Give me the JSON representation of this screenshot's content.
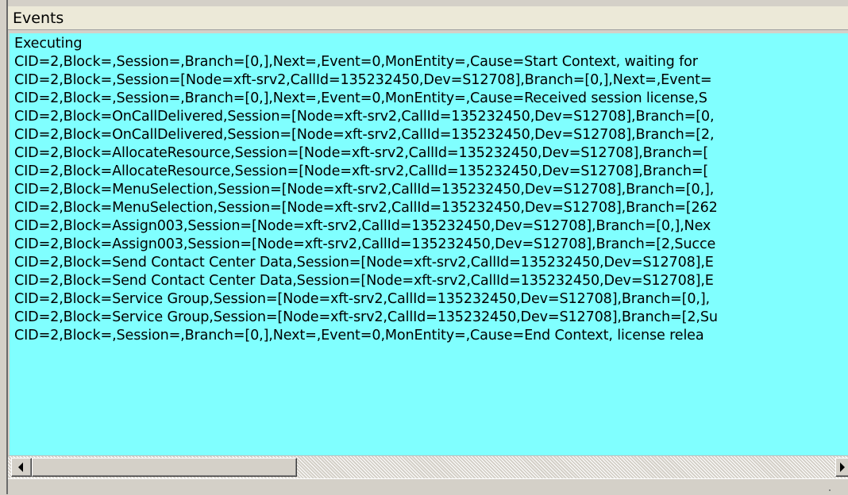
{
  "panel": {
    "title": "Events"
  },
  "events": {
    "lines": [
      "Executing",
      "CID=2,Block=,Session=,Branch=[0,],Next=,Event=0,MonEntity=,Cause=Start Context, waiting for",
      "CID=2,Block=,Session=[Node=xft-srv2,CallId=135232450,Dev=S12708],Branch=[0,],Next=,Event=",
      "CID=2,Block=,Session=,Branch=[0,],Next=,Event=0,MonEntity=,Cause=Received session license,S",
      "CID=2,Block=OnCallDelivered,Session=[Node=xft-srv2,CallId=135232450,Dev=S12708],Branch=[0,",
      "CID=2,Block=OnCallDelivered,Session=[Node=xft-srv2,CallId=135232450,Dev=S12708],Branch=[2,",
      "CID=2,Block=AllocateResource,Session=[Node=xft-srv2,CallId=135232450,Dev=S12708],Branch=[",
      "CID=2,Block=AllocateResource,Session=[Node=xft-srv2,CallId=135232450,Dev=S12708],Branch=[",
      "CID=2,Block=MenuSelection,Session=[Node=xft-srv2,CallId=135232450,Dev=S12708],Branch=[0,],",
      "CID=2,Block=MenuSelection,Session=[Node=xft-srv2,CallId=135232450,Dev=S12708],Branch=[262",
      "CID=2,Block=Assign003,Session=[Node=xft-srv2,CallId=135232450,Dev=S12708],Branch=[0,],Nex",
      "CID=2,Block=Assign003,Session=[Node=xft-srv2,CallId=135232450,Dev=S12708],Branch=[2,Succe",
      "CID=2,Block=Send Contact Center Data,Session=[Node=xft-srv2,CallId=135232450,Dev=S12708],E",
      "CID=2,Block=Send Contact Center Data,Session=[Node=xft-srv2,CallId=135232450,Dev=S12708],E",
      "CID=2,Block=Service Group,Session=[Node=xft-srv2,CallId=135232450,Dev=S12708],Branch=[0,],",
      "CID=2,Block=Service Group,Session=[Node=xft-srv2,CallId=135232450,Dev=S12708],Branch=[2,Su",
      "CID=2,Block=,Session=,Branch=[0,],Next=,Event=0,MonEntity=,Cause=End Context, license relea"
    ]
  },
  "scrollbar": {
    "left_icon": "left-arrow-icon",
    "right_icon": "right-arrow-icon"
  },
  "colors": {
    "events_background": "#80ffff",
    "chrome": "#d4d0c8"
  }
}
